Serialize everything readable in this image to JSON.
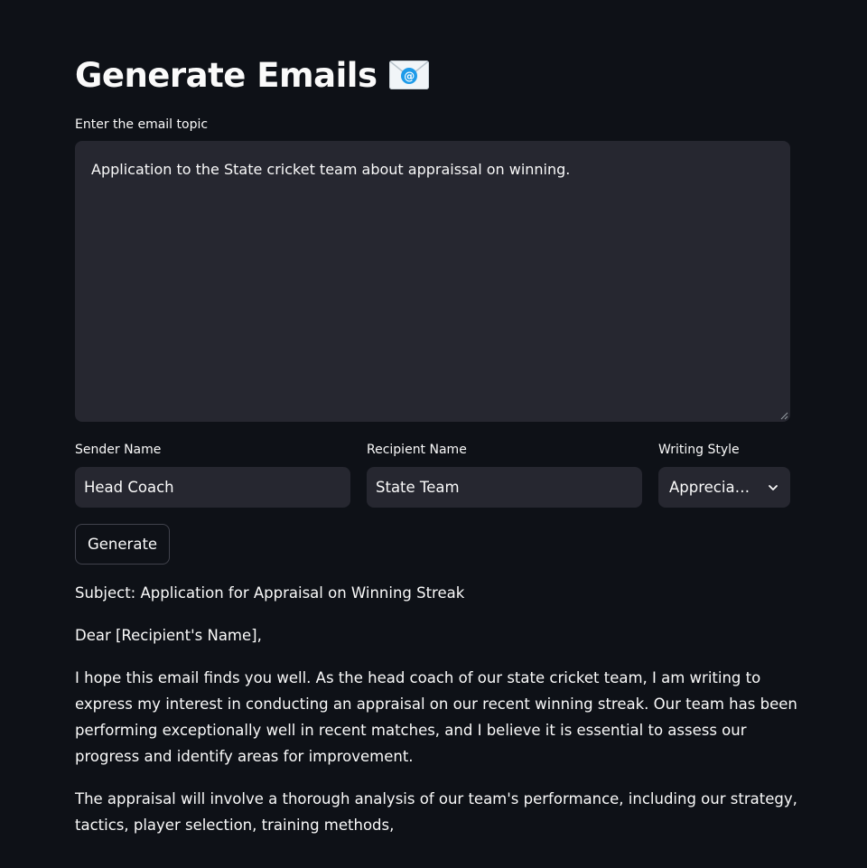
{
  "page": {
    "title": "Generate Emails",
    "title_icon": "envelope-with-arrow-icon"
  },
  "topic": {
    "label": "Enter the email topic",
    "value": "Application to the State cricket team about appraissal on winning."
  },
  "sender": {
    "label": "Sender Name",
    "value": "Head Coach"
  },
  "recipient": {
    "label": "Recipient Name",
    "value": "State Team"
  },
  "style": {
    "label": "Writing Style",
    "value": "Apprecia…"
  },
  "generate_button": {
    "label": "Generate"
  },
  "output": {
    "subject": "Subject: Application for Appraisal on Winning Streak",
    "greeting": "Dear [Recipient's Name],",
    "paragraph1": "I hope this email finds you well. As the head coach of our state cricket team, I am writing to express my interest in conducting an appraisal on our recent winning streak. Our team has been performing exceptionally well in recent matches, and I believe it is essential to assess our progress and identify areas for improvement.",
    "paragraph2": "The appraisal will involve a thorough analysis of our team's performance, including our strategy, tactics, player selection, training methods,"
  },
  "colors": {
    "background": "#0e1117",
    "field": "#262730",
    "text": "#fafafa",
    "border": "#40424c"
  }
}
